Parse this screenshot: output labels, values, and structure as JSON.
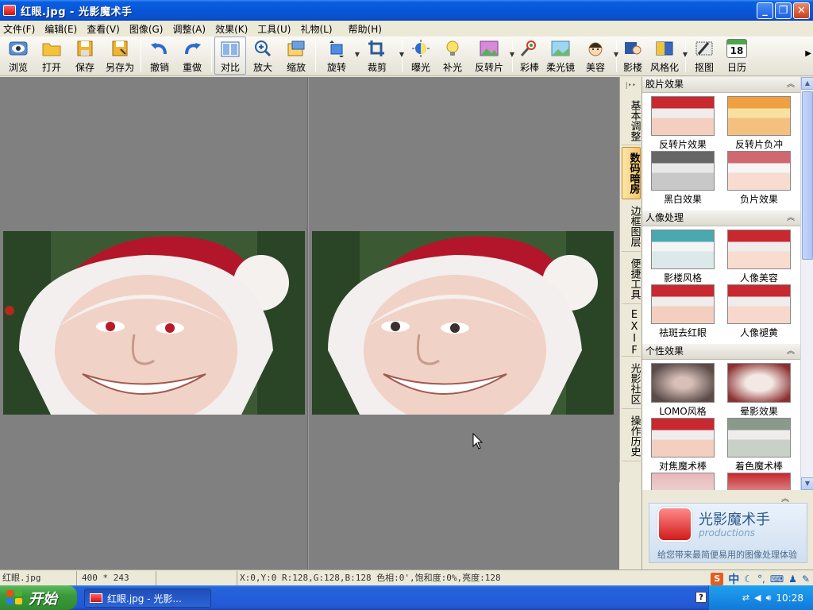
{
  "window": {
    "title": "红眼.jpg - 光影魔术手",
    "minimize": "_",
    "maximize": "❐",
    "close": "✕"
  },
  "menu": [
    "文件(F)",
    "编辑(E)",
    "查看(V)",
    "图像(G)",
    "调整(A)",
    "效果(K)",
    "工具(U)",
    "礼物(L)",
    "帮助(H)"
  ],
  "toolbar": {
    "browse": "浏览",
    "open": "打开",
    "save": "保存",
    "save_as": "另存为",
    "undo": "撤销",
    "redo": "重做",
    "compare": "对比",
    "zoom_in": "放大",
    "resize": "缩放",
    "rotate": "旋转",
    "crop": "裁剪",
    "exposure": "曝光",
    "fill_light": "补光",
    "reversal": "反转片",
    "magic_wand": "彩棒",
    "soft_focus": "柔光镜",
    "beauty": "美容",
    "studio": "影楼",
    "stylize": "风格化",
    "cutout": "抠图",
    "calendar": "日历",
    "calendar_day": "18"
  },
  "sidetabs": [
    "基本调整",
    "数码暗房",
    "边框图层",
    "便捷工具",
    "EXIF",
    "光影社区",
    "操作历史"
  ],
  "panel": {
    "sections": [
      {
        "title": "胶片效果",
        "items": [
          "反转片效果",
          "反转片负冲",
          "黑白效果",
          "负片效果"
        ]
      },
      {
        "title": "人像处理",
        "items": [
          "影楼风格",
          "人像美容",
          "祛斑去红眼",
          "人像褪黄"
        ]
      },
      {
        "title": "个性效果",
        "items": [
          "LOMO风格",
          "晕影效果",
          "对焦魔术棒",
          "着色魔术棒"
        ]
      }
    ]
  },
  "ad": {
    "title": "光影魔术手",
    "subtitle": "productions",
    "tagline": "给您带来最简便易用的图像处理体验"
  },
  "status": {
    "filename": "红眼.jpg",
    "dimensions": "400 * 243",
    "pixel_info": "X:0,Y:0 R:128,G:128,B:128 色相:0',饱和度:0%,亮度:128"
  },
  "ime": {
    "brand": "S",
    "lang": "中"
  },
  "taskbar": {
    "start": "开始",
    "task": "红眼.jpg - 光影...",
    "clock": "10:28"
  }
}
